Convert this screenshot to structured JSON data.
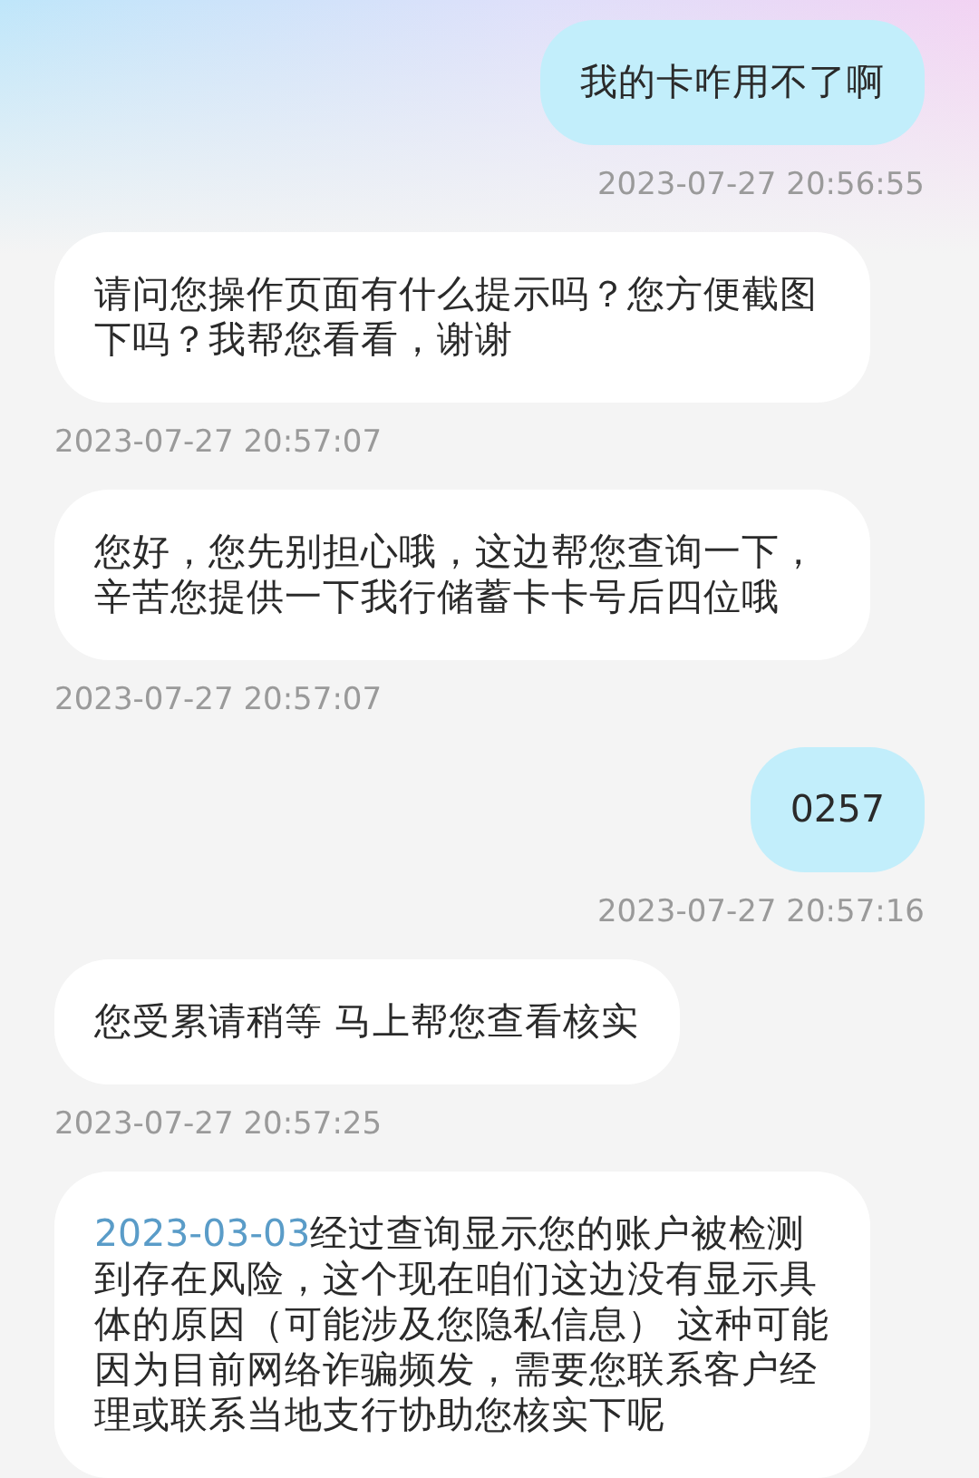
{
  "messages": [
    {
      "kind": "outgoing",
      "text": "我的卡咋用不了啊",
      "time": "2023-07-27 20:56:55"
    },
    {
      "kind": "incoming",
      "text": "请问您操作页面有什么提示吗？您方便截图下吗？我帮您看看，谢谢",
      "time": "2023-07-27 20:57:07"
    },
    {
      "kind": "incoming",
      "text": "您好，您先别担心哦，这边帮您查询一下，辛苦您提供一下我行储蓄卡卡号后四位哦",
      "time": "2023-07-27 20:57:07"
    },
    {
      "kind": "outgoing",
      "text": "0257",
      "time": "2023-07-27 20:57:16"
    },
    {
      "kind": "incoming",
      "text": "您受累请稍等 马上帮您查看核实",
      "time": "2023-07-27 20:57:25"
    },
    {
      "kind": "incoming",
      "link": "2023-03-03",
      "text": "经过查询显示您的账户被检测到存在风险，这个现在咱们这边没有显示具体的原因（可能涉及您隐私信息） 这种可能因为目前网络诈骗频发，需要您联系客户经理或联系当地支行协助您核实下呢"
    }
  ]
}
